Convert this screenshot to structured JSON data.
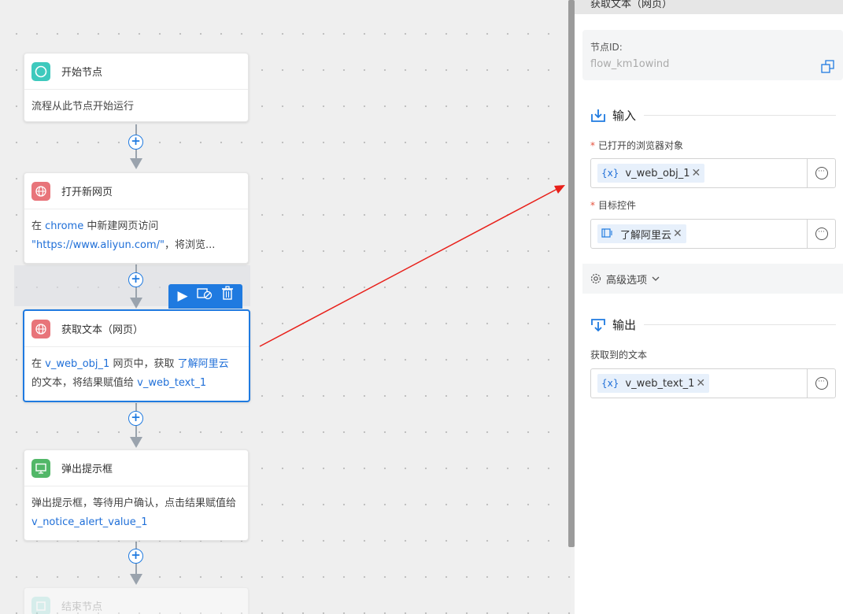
{
  "canvas": {
    "nodes": {
      "start": {
        "title": "开始节点",
        "body": "流程从此节点开始运行"
      },
      "open_page": {
        "title": "打开新网页",
        "body_pre": "在 ",
        "browser": "chrome",
        "body_mid": " 中新建网页访问",
        "url": "\"https://www.aliyun.com/\"",
        "body_post": "，将浏览..."
      },
      "get_text": {
        "title": "获取文本（网页）",
        "body_pre": "在 ",
        "obj": "v_web_obj_1",
        "body_mid": " 网页中，获取 ",
        "target": "了解阿里云",
        "body_mid2": "的文本，将结果赋值给 ",
        "result": "v_web_text_1"
      },
      "alert": {
        "title": "弹出提示框",
        "body_pre": "弹出提示框，等待用户确认，点击结果赋值给 ",
        "result": "v_notice_alert_value_1"
      },
      "end": {
        "title": "结束节点"
      }
    },
    "toolbar": {
      "run": "▶",
      "disable": "⊘",
      "delete": "🗑"
    }
  },
  "panel": {
    "header_title": "获取文本（网页）",
    "node_id_label": "节点ID:",
    "node_id_value": "flow_km1owind",
    "input_section": "输入",
    "field_browser_label": "已打开的浏览器对象",
    "field_browser_value": "v_web_obj_1",
    "field_target_label": "目标控件",
    "field_target_value": "了解阿里云",
    "advanced_label": "高级选项",
    "output_section": "输出",
    "field_output_label": "获取到的文本",
    "field_output_value": "v_web_text_1",
    "var_badge": "{x}",
    "remove_glyph": "✕",
    "more_glyph": "···",
    "required_mark": "*"
  }
}
